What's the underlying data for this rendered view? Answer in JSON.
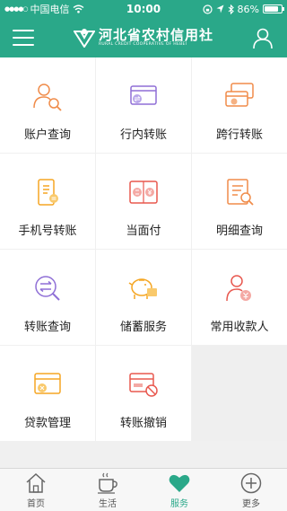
{
  "status": {
    "carrier": "中国电信",
    "time": "10:00",
    "battery": "86%",
    "battery_level": 0.86
  },
  "header": {
    "brand_name": "河北省农村信用社",
    "brand_sub": "RURAL CREDIT COOPERATIVE OF HEBEI"
  },
  "menu": [
    {
      "label": "账户查询",
      "icon": "account-search-icon",
      "color": "#f08c4a"
    },
    {
      "label": "行内转账",
      "icon": "intra-transfer-card-icon",
      "color": "#8f6fd6"
    },
    {
      "label": "跨行转账",
      "icon": "inter-bank-transfer-icon",
      "color": "#f08c4a"
    },
    {
      "label": "手机号转账",
      "icon": "phone-transfer-icon",
      "color": "#f5a623"
    },
    {
      "label": "当面付",
      "icon": "face-to-face-pay-icon",
      "color": "#e8584f"
    },
    {
      "label": "明细查询",
      "icon": "detail-search-icon",
      "color": "#f08c4a"
    },
    {
      "label": "转账查询",
      "icon": "transfer-search-icon",
      "color": "#8f6fd6"
    },
    {
      "label": "储蓄服务",
      "icon": "piggy-bank-icon",
      "color": "#f5a623"
    },
    {
      "label": "常用收款人",
      "icon": "payee-icon",
      "color": "#e8584f"
    },
    {
      "label": "贷款管理",
      "icon": "loan-card-icon",
      "color": "#f5a623"
    },
    {
      "label": "转账撤销",
      "icon": "transfer-cancel-icon",
      "color": "#e8584f"
    }
  ],
  "tabs": [
    {
      "label": "首页",
      "icon": "home-icon"
    },
    {
      "label": "生活",
      "icon": "coffee-cup-icon"
    },
    {
      "label": "服务",
      "icon": "heart-icon"
    },
    {
      "label": "更多",
      "icon": "plus-circle-icon"
    }
  ],
  "colors": {
    "primary": "#2aa889"
  }
}
